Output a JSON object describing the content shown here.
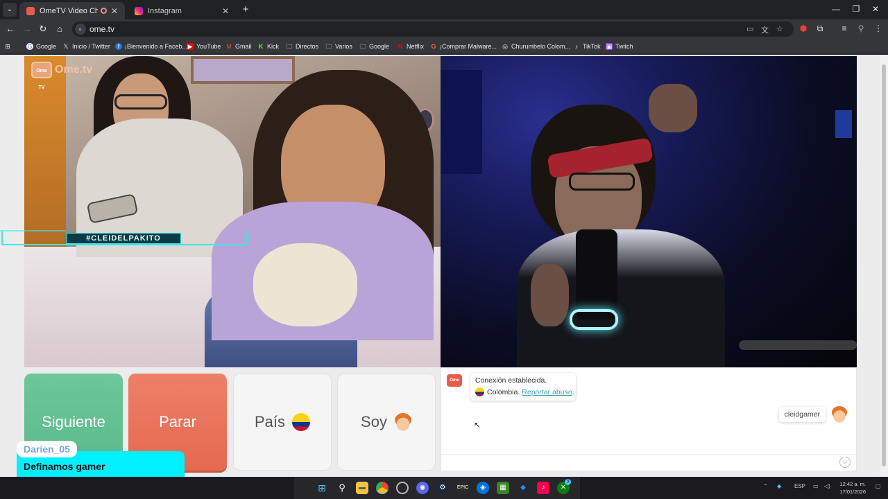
{
  "browser": {
    "tabs": [
      {
        "title": "OmeTV Video Chat — Ome",
        "active": true
      },
      {
        "title": "Instagram",
        "active": false
      }
    ],
    "url": "ome.tv",
    "bookmarks": [
      "Google",
      "Inicio / Twitter",
      "¡Bienvenido a Faceb...",
      "YouTube",
      "Gmail",
      "Kick",
      "Directos",
      "Varios",
      "Google",
      "Netflix",
      "¡Comprar  Malware...",
      "Churumbelo Colom...",
      "TikTok",
      "Twitch"
    ]
  },
  "video": {
    "logo_text": "Ome.tv",
    "logo_badge": "Ome TV",
    "hashtag": "#CLEIDELPAKITO"
  },
  "controls": {
    "next_label": "Siguiente",
    "stop_label": "Parar",
    "country_label": "País",
    "gender_label": "Soy"
  },
  "chat": {
    "system_title": "Conexión establecida.",
    "country": "Colombia.",
    "report_link": "Reportar abuso",
    "report_suffix": ".",
    "self_username": "cleidgamer"
  },
  "overlay": {
    "username": "Darien_05",
    "message": "Definamos gamer"
  },
  "taskbar": {
    "tray_lang": "ESP",
    "time": "12:42 a. m.",
    "date": "17/01/2026",
    "badge_count": "3"
  },
  "colors": {
    "next": "#5bb98a",
    "stop": "#e4694f",
    "link": "#3a9fb0",
    "overlay": "#00f0ff"
  }
}
